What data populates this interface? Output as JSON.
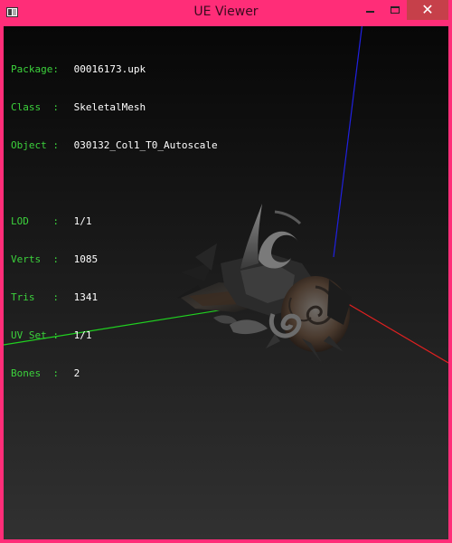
{
  "window": {
    "title": "UE Viewer",
    "close_glyph": "✕",
    "frame_color": "#ff2d78",
    "close_color": "#c6404a"
  },
  "info": {
    "package": {
      "label": "Package:",
      "value": "00016173.upk"
    },
    "class": {
      "label": "Class  :",
      "value": "SkeletalMesh"
    },
    "object": {
      "label": "Object :",
      "value": "030132_Col1_T0_Autoscale"
    },
    "lod": {
      "label": "LOD    :",
      "value": "1/1"
    },
    "verts": {
      "label": "Verts  :",
      "value": "1085"
    },
    "tris": {
      "label": "Tris   :",
      "value": "1341"
    },
    "uvset": {
      "label": "UV Set :",
      "value": "1/1"
    },
    "bones": {
      "label": "Bones  :",
      "value": "2"
    }
  },
  "colors": {
    "label_text": "#3cd23c",
    "value_text": "#ffffff",
    "axis_x": "#e02020",
    "axis_y": "#20d020",
    "axis_z": "#2020e0"
  },
  "icons": {
    "app": "ue-viewer-app-icon",
    "minimize": "minimize-icon",
    "maximize": "maximize-icon",
    "close": "close-icon"
  }
}
